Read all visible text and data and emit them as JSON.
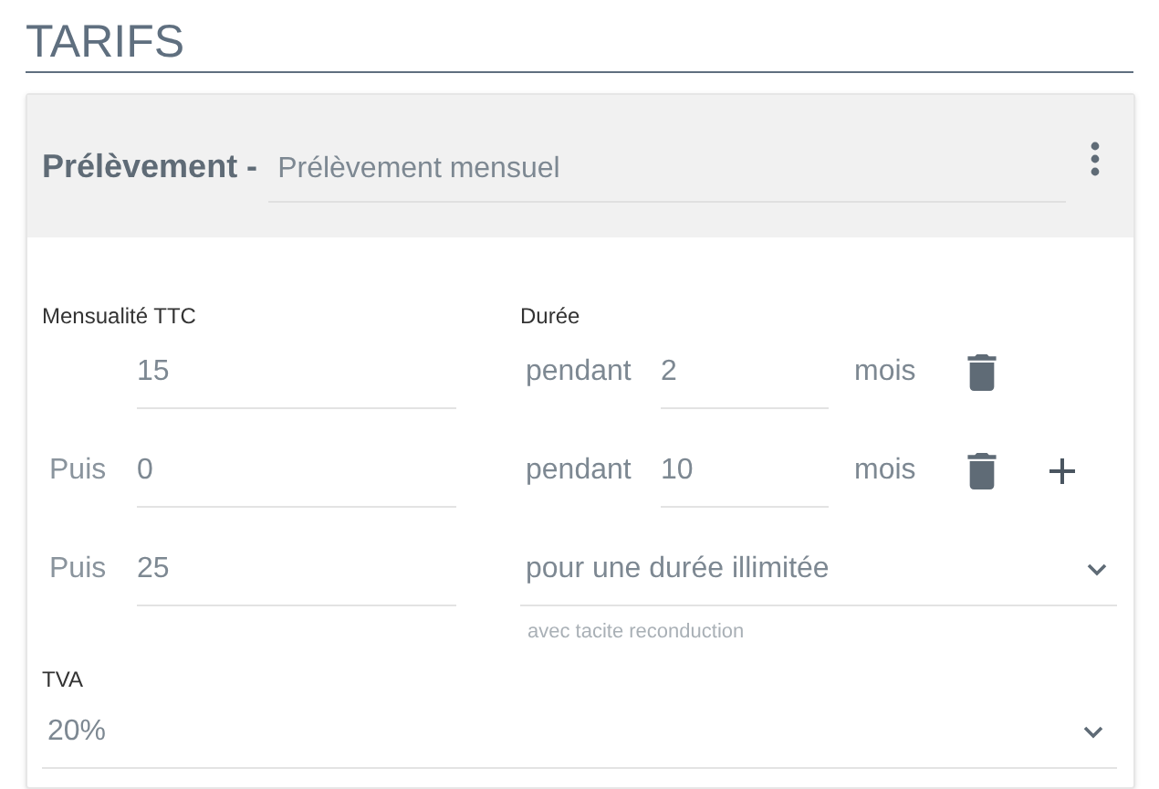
{
  "section_title": "TARIFS",
  "card": {
    "type_label": "Prélèvement -",
    "name_value": "Prélèvement mensuel"
  },
  "columns": {
    "amount_label": "Mensualité TTC",
    "duration_label": "Durée"
  },
  "rows": [
    {
      "kind": "fixed",
      "prefix": null,
      "amount": "15",
      "duration_prefix": "pendant",
      "duration": "2",
      "unit": "mois",
      "addable": false
    },
    {
      "kind": "fixed",
      "prefix": "Puis",
      "amount": "0",
      "duration_prefix": "pendant",
      "duration": "10",
      "unit": "mois",
      "addable": true
    },
    {
      "kind": "unlimited",
      "prefix": "Puis",
      "amount": "25",
      "duration_choice": "pour une durée illimitée",
      "hint": "avec tacite reconduction"
    }
  ],
  "vat": {
    "label": "TVA",
    "value": "20%"
  }
}
